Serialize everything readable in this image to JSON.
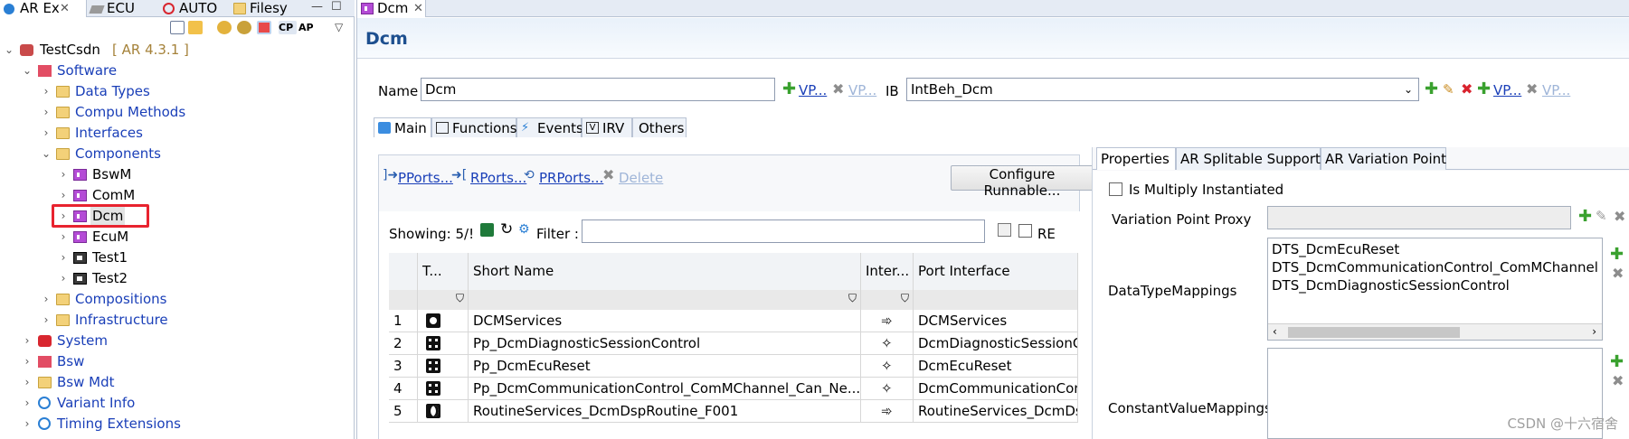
{
  "left_tabs": [
    {
      "label": "AR Ex",
      "active": true
    },
    {
      "label": "ECU",
      "active": false
    },
    {
      "label": "AUTO",
      "active": false
    },
    {
      "label": "Filesy",
      "active": false
    }
  ],
  "left_toolbar": {
    "cp_label": "CP",
    "ap_label": "AP"
  },
  "tree": {
    "root_label": "TestCsdn",
    "root_version": "[ AR 4.3.1 ]",
    "software": "Software",
    "data_types": "Data Types",
    "compu_methods": "Compu Methods",
    "interfaces": "Interfaces",
    "components": "Components",
    "bswm": "BswM",
    "comm": "ComM",
    "dcm": "Dcm",
    "ecum": "EcuM",
    "test1": "Test1",
    "test2": "Test2",
    "compositions": "Compositions",
    "infrastructure": "Infrastructure",
    "system": "System",
    "bsw": "Bsw",
    "bsw_mdt": "Bsw Mdt",
    "variant_info": "Variant Info",
    "timing_extensions": "Timing Extensions"
  },
  "editor": {
    "tab_label": "Dcm",
    "title": "Dcm",
    "name_label": "Name",
    "name_value": "Dcm",
    "vp_label": "VP...",
    "ib_label": "IB",
    "ib_value": "IntBeh_Dcm"
  },
  "subtabs": [
    "Main",
    "Functions",
    "Events",
    "IRV",
    "Others"
  ],
  "port_actions": {
    "pports": "PPorts...",
    "rports": "RPorts...",
    "prports": "PRPorts...",
    "delete": "Delete",
    "configure": "Configure Runnable..."
  },
  "table": {
    "showing": "Showing: 5/!",
    "filter_label": "Filter :",
    "filter_value": "",
    "re_label": "RE",
    "headers": [
      "T...",
      "Short Name",
      "Inter...",
      "Port Interface"
    ],
    "rows": [
      {
        "num": "1",
        "type": "ring",
        "short_name": "DCMServices",
        "inter": "client-server",
        "port_interface": "DCMServices"
      },
      {
        "num": "2",
        "type": "dots",
        "short_name": "Pp_DcmDiagnosticSessionControl",
        "inter": "mode-switch",
        "port_interface": "DcmDiagnosticSessionCont"
      },
      {
        "num": "3",
        "type": "dots",
        "short_name": "Pp_DcmEcuReset",
        "inter": "mode-switch",
        "port_interface": "DcmEcuReset"
      },
      {
        "num": "4",
        "type": "dots",
        "short_name": "Pp_DcmCommunicationControl_ComMChannel_Can_Ne...",
        "inter": "mode-switch",
        "port_interface": "DcmCommunicationContro"
      },
      {
        "num": "5",
        "type": "moon",
        "short_name": "RoutineServices_DcmDspRoutine_F001",
        "inter": "client-server",
        "port_interface": "RoutineServices_DcmDspRo"
      }
    ]
  },
  "properties": {
    "tabs": [
      "Properties",
      "AR Splitable Support",
      "AR Variation Point"
    ],
    "is_multiply_instantiated": "Is Multiply Instantiated",
    "variation_point_proxy": "Variation Point Proxy",
    "data_type_mappings_label": "DataTypeMappings",
    "data_type_mappings": [
      "DTS_DcmEcuReset",
      "DTS_DcmCommunicationControl_ComMChannel",
      "DTS_DcmDiagnosticSessionControl"
    ],
    "constant_value_mappings_label": "ConstantValueMappings"
  },
  "watermark": "CSDN @十六宿舍"
}
